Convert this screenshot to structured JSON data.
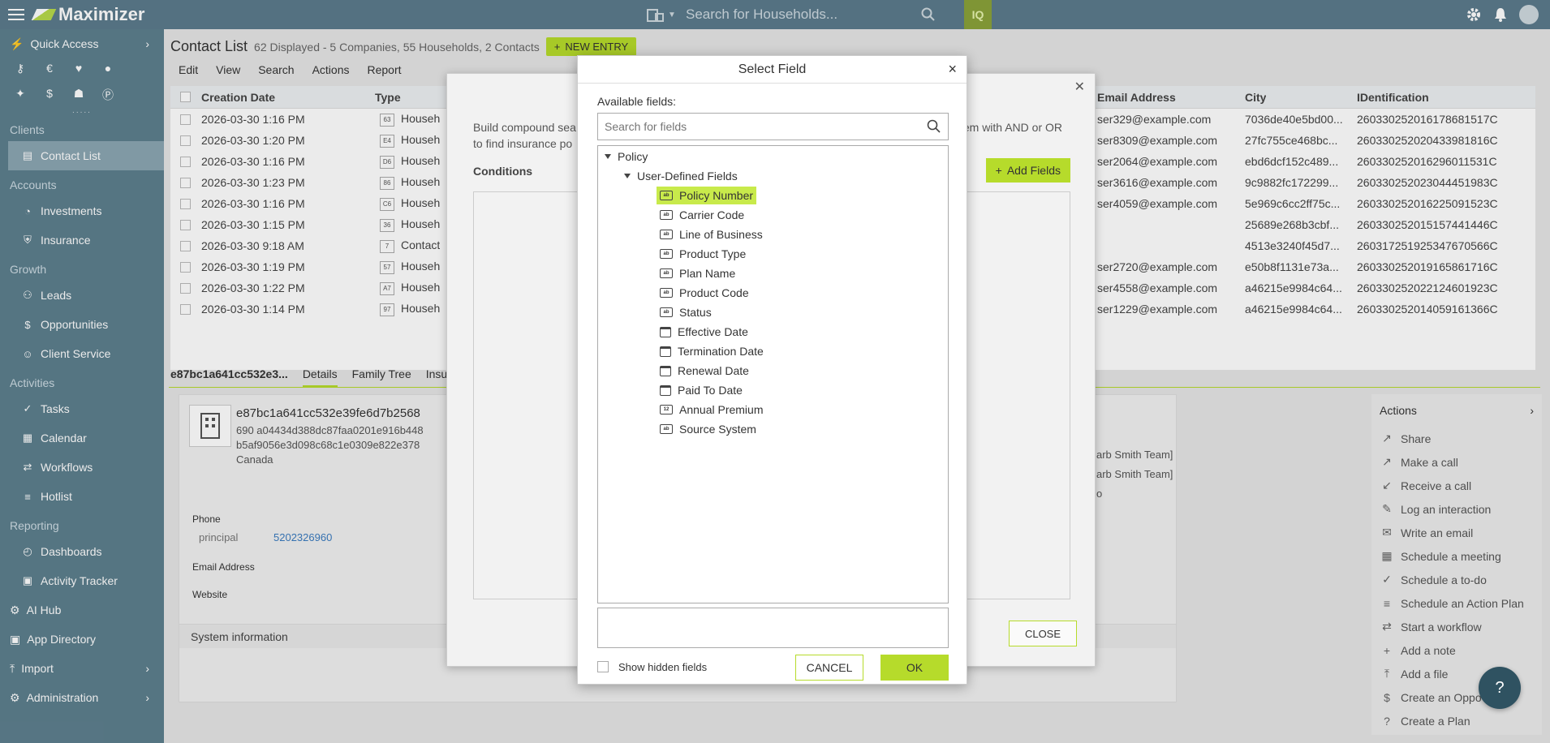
{
  "topbar": {
    "app_name": "Maximizer",
    "search_placeholder": "Search for Households...",
    "iq_label": "IQ"
  },
  "sidebar": {
    "quick_access": "Quick Access",
    "sections": [
      {
        "title": "Clients",
        "items": [
          {
            "label": "Contact List",
            "icon": "contact-list-icon"
          }
        ]
      },
      {
        "title": "Accounts",
        "items": [
          {
            "label": "Investments",
            "icon": "investments-icon"
          },
          {
            "label": "Insurance",
            "icon": "insurance-icon"
          }
        ]
      },
      {
        "title": "Growth",
        "items": [
          {
            "label": "Leads",
            "icon": "leads-icon"
          },
          {
            "label": "Opportunities",
            "icon": "dollar-icon"
          },
          {
            "label": "Client Service",
            "icon": "client-service-icon"
          }
        ]
      },
      {
        "title": "Activities",
        "items": [
          {
            "label": "Tasks",
            "icon": "tasks-icon"
          },
          {
            "label": "Calendar",
            "icon": "calendar-icon"
          },
          {
            "label": "Workflows",
            "icon": "workflows-icon"
          },
          {
            "label": "Hotlist",
            "icon": "hotlist-icon"
          }
        ]
      },
      {
        "title": "Reporting",
        "items": [
          {
            "label": "Dashboards",
            "icon": "dashboards-icon"
          },
          {
            "label": "Activity Tracker",
            "icon": "activity-tracker-icon"
          }
        ]
      }
    ],
    "bottom": {
      "ai_hub": "AI Hub",
      "app_directory": "App Directory",
      "import": "Import",
      "administration": "Administration"
    }
  },
  "contact_list": {
    "title": "Contact List",
    "subtitle": "62 Displayed - 5 Companies, 55 Households, 2 Contacts",
    "new_entry": "NEW ENTRY",
    "menu": [
      "Edit",
      "View",
      "Search",
      "Actions",
      "Report"
    ],
    "columns": {
      "creation_date": "Creation Date",
      "type": "Type",
      "email": "Email Address",
      "city": "City",
      "identification": "IDentification"
    },
    "rows": [
      {
        "date": "2026-03-30 1:16 PM",
        "badge": "63",
        "type": "Househ",
        "email": "ser329@example.com",
        "city": "7036de40e5bd00...",
        "id": "260330252016178681517C"
      },
      {
        "date": "2026-03-30 1:20 PM",
        "badge": "E4",
        "type": "Househ",
        "email": "ser8309@example.com",
        "city": "27fc755ce468bc...",
        "id": "260330252020433981816C"
      },
      {
        "date": "2026-03-30 1:16 PM",
        "badge": "D6",
        "type": "Househ",
        "email": "ser2064@example.com",
        "city": "ebd6dcf152c489...",
        "id": "260330252016296011531C"
      },
      {
        "date": "2026-03-30 1:23 PM",
        "badge": "86",
        "type": "Househ",
        "email": "ser3616@example.com",
        "city": "9c9882fc172299...",
        "id": "260330252023044451983C"
      },
      {
        "date": "2026-03-30 1:16 PM",
        "badge": "C6",
        "type": "Househ",
        "email": "ser4059@example.com",
        "city": "5e969c6cc2ff75c...",
        "id": "260330252016225091523C"
      },
      {
        "date": "2026-03-30 1:15 PM",
        "badge": "36",
        "type": "Househ",
        "email": "",
        "city": "25689e268b3cbf...",
        "id": "260330252015157441446C"
      },
      {
        "date": "2026-03-30 9:18 AM",
        "badge": "7",
        "type": "Contact",
        "email": "",
        "city": "4513e3240f45d7...",
        "id": "260317251925347670566C"
      },
      {
        "date": "2026-03-30 1:19 PM",
        "badge": "57",
        "type": "Househ",
        "email": "ser2720@example.com",
        "city": "e50b8f1131e73a...",
        "id": "260330252019165861716C"
      },
      {
        "date": "2026-03-30 1:22 PM",
        "badge": "A7",
        "type": "Househ",
        "email": "ser4558@example.com",
        "city": "a46215e9984c64...",
        "id": "260330252022124601923C"
      },
      {
        "date": "2026-03-30 1:14 PM",
        "badge": "97",
        "type": "Househ",
        "email": "ser1229@example.com",
        "city": "a46215e9984c64...",
        "id": "260330252014059161366C"
      }
    ]
  },
  "detail": {
    "record_selector": "e87bc1a641cc532e3...",
    "tabs": [
      "Details",
      "Family Tree",
      "Insu"
    ],
    "name": "e87bc1a641cc532e39fe6d7b2568",
    "address_line1": "690 a04434d388dc87faa0201e916b448",
    "address_line2": "b5af9056e3d098c68c1e0309e822e378",
    "country": "Canada",
    "phone_label": "Phone",
    "phone_type": "principal",
    "phone_value": "5202326960",
    "email_label": "Email Address",
    "website_label": "Website",
    "system_info": "System information",
    "team_1": "arb Smith Team]",
    "team_2": "arb Smith Team]",
    "team_3": "o"
  },
  "actions_panel": {
    "title": "Actions",
    "items": [
      {
        "label": "Share",
        "icon": "share-icon"
      },
      {
        "label": "Make a call",
        "icon": "outgoing-call-icon"
      },
      {
        "label": "Receive a call",
        "icon": "incoming-call-icon"
      },
      {
        "label": "Log an interaction",
        "icon": "log-icon"
      },
      {
        "label": "Write an email",
        "icon": "email-icon"
      },
      {
        "label": "Schedule a meeting",
        "icon": "meeting-icon"
      },
      {
        "label": "Schedule a to-do",
        "icon": "todo-icon"
      },
      {
        "label": "Schedule an Action Plan",
        "icon": "action-plan-icon"
      },
      {
        "label": "Start a workflow",
        "icon": "workflow-icon"
      },
      {
        "label": "Add a note",
        "icon": "note-icon"
      },
      {
        "label": "Add a file",
        "icon": "file-icon"
      },
      {
        "label": "Create an Oppo",
        "icon": "dollar-icon"
      },
      {
        "label": "Create a Plan",
        "icon": "plan-icon"
      }
    ]
  },
  "builder_dialog": {
    "desc_left_1": "Build compound sea",
    "desc_left_2": "to find insurance po",
    "desc_right": "em with AND or OR",
    "conditions": "Conditions",
    "add_fields": "Add Fields",
    "close": "CLOSE"
  },
  "select_field": {
    "title": "Select Field",
    "available_label": "Available fields:",
    "search_placeholder": "Search for fields",
    "root": "Policy",
    "group": "User-Defined Fields",
    "fields": [
      {
        "label": "Policy Number",
        "kind": "text",
        "selected": true
      },
      {
        "label": "Carrier Code",
        "kind": "text"
      },
      {
        "label": "Line of Business",
        "kind": "text"
      },
      {
        "label": "Product Type",
        "kind": "text"
      },
      {
        "label": "Plan Name",
        "kind": "text"
      },
      {
        "label": "Product Code",
        "kind": "text"
      },
      {
        "label": "Status",
        "kind": "text"
      },
      {
        "label": "Effective Date",
        "kind": "date"
      },
      {
        "label": "Termination Date",
        "kind": "date"
      },
      {
        "label": "Renewal Date",
        "kind": "date"
      },
      {
        "label": "Paid To Date",
        "kind": "date"
      },
      {
        "label": "Annual Premium",
        "kind": "number"
      },
      {
        "label": "Source System",
        "kind": "text"
      }
    ],
    "show_hidden": "Show hidden fields",
    "cancel": "CANCEL",
    "ok": "OK"
  },
  "colors": {
    "accent": "#b6db2b",
    "sidebar": "#5d7f8e",
    "topbar": "#5c7b8c",
    "selected": "#c8ea4b"
  }
}
